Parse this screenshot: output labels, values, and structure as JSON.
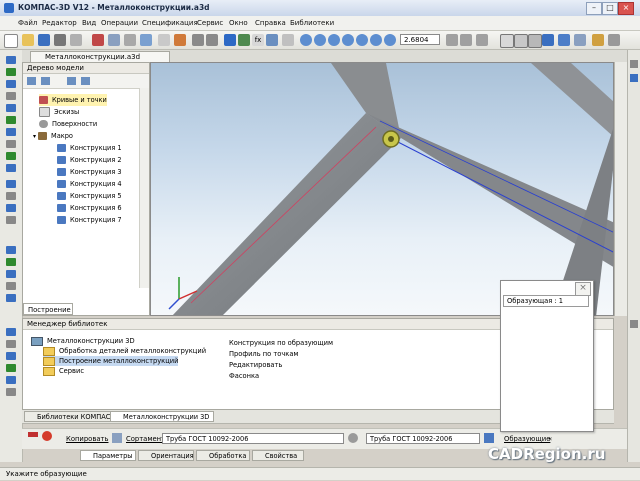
{
  "window": {
    "title": "КОМПАС-3D V12 - Металлоконструкции.a3d"
  },
  "menu": [
    "Файл",
    "Редактор",
    "Вид",
    "Операции",
    "Спецификация",
    "Сервис",
    "Окно",
    "Справка",
    "Библиотеки"
  ],
  "toolbar": {
    "zoom_value": "2.6804"
  },
  "doc_tab": {
    "label": "Металлоконструкции.a3d"
  },
  "tree": {
    "header": "Дерево модели",
    "items": [
      {
        "label": "Кривые и точки",
        "highlighted": true
      },
      {
        "label": "Эскизы"
      },
      {
        "label": "Поверхности"
      },
      {
        "label": "Макро"
      },
      {
        "label": "Конструкция 1"
      },
      {
        "label": "Конструкция 2"
      },
      {
        "label": "Конструкция 3"
      },
      {
        "label": "Конструкция 4"
      },
      {
        "label": "Конструкция 5"
      },
      {
        "label": "Конструкция 6"
      },
      {
        "label": "Конструкция 7"
      }
    ],
    "tab": "Построение"
  },
  "library_manager": {
    "header": "Менеджер библиотек",
    "root": "Металлоконструкции 3D",
    "folders": [
      "Обработка деталей металлоконструкций",
      "Построение металлоконструкций",
      "Сервис"
    ],
    "commands": [
      "Конструкция по образующим",
      "Профиль по точкам",
      "Редактировать",
      "Фасонка"
    ]
  },
  "library_tabs": [
    "Библиотеки КОМПАС",
    "Металлоконструкции 3D"
  ],
  "properties": {
    "copy_label": "Копировать",
    "assortment_label": "Сортамент",
    "profile_value_1": "Труба ГОСТ 10092-2006",
    "profile_value_2": "Труба ГОСТ 10092-2006",
    "generatrix_label": "Образующие",
    "tabs": [
      "Параметры",
      "Ориентация",
      "Обработка",
      "Свойства"
    ]
  },
  "dialog": {
    "field": "Образующая : 1"
  },
  "status": {
    "text": "Укажите образующие"
  },
  "watermark": "CADRegion.ru",
  "colors": {
    "accent": "#2d69c5",
    "beam": "#8a8d90",
    "sky_top": "#a9c1d8"
  }
}
